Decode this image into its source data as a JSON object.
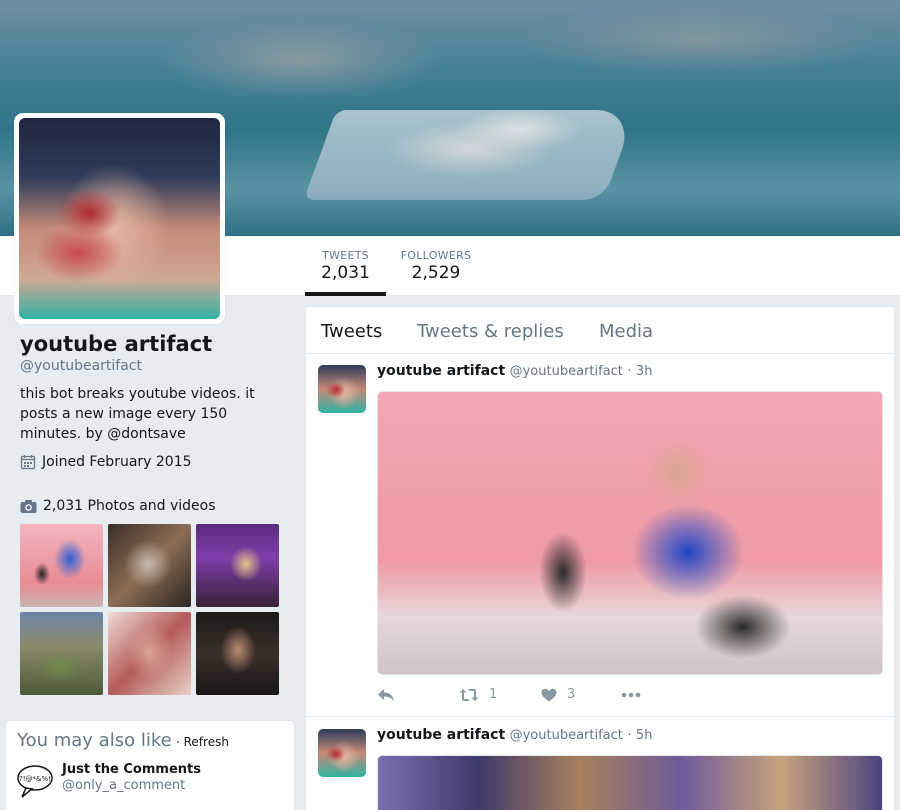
{
  "profile": {
    "name": "youtube artifact",
    "handle": "@youtubeartifact",
    "bio": "this bot breaks youtube videos. it posts a new image every 150 minutes. by @dontsave",
    "joined": "Joined February 2015",
    "photos_label": "2,031 Photos and videos"
  },
  "nav": {
    "stats": [
      {
        "label": "TWEETS",
        "value": "2,031",
        "active": true
      },
      {
        "label": "FOLLOWERS",
        "value": "2,529",
        "active": false
      }
    ]
  },
  "timeline": {
    "tabs": [
      "Tweets",
      "Tweets & replies",
      "Media"
    ],
    "active_tab": "Tweets",
    "tweets": [
      {
        "name": "youtube artifact",
        "handle": "@youtubeartifact",
        "dot": "·",
        "time": "3h",
        "retweets": "1",
        "likes": "3"
      },
      {
        "name": "youtube artifact",
        "handle": "@youtubeartifact",
        "dot": "·",
        "time": "5h"
      }
    ]
  },
  "who_to_follow": {
    "title": "You may also like",
    "refresh": "· Refresh",
    "accounts": [
      {
        "name": "Just the Comments",
        "handle": "@only_a_comment"
      }
    ]
  },
  "colors": {
    "accent": "#14171a",
    "muted": "#657786",
    "background": "#e6ecf0"
  }
}
